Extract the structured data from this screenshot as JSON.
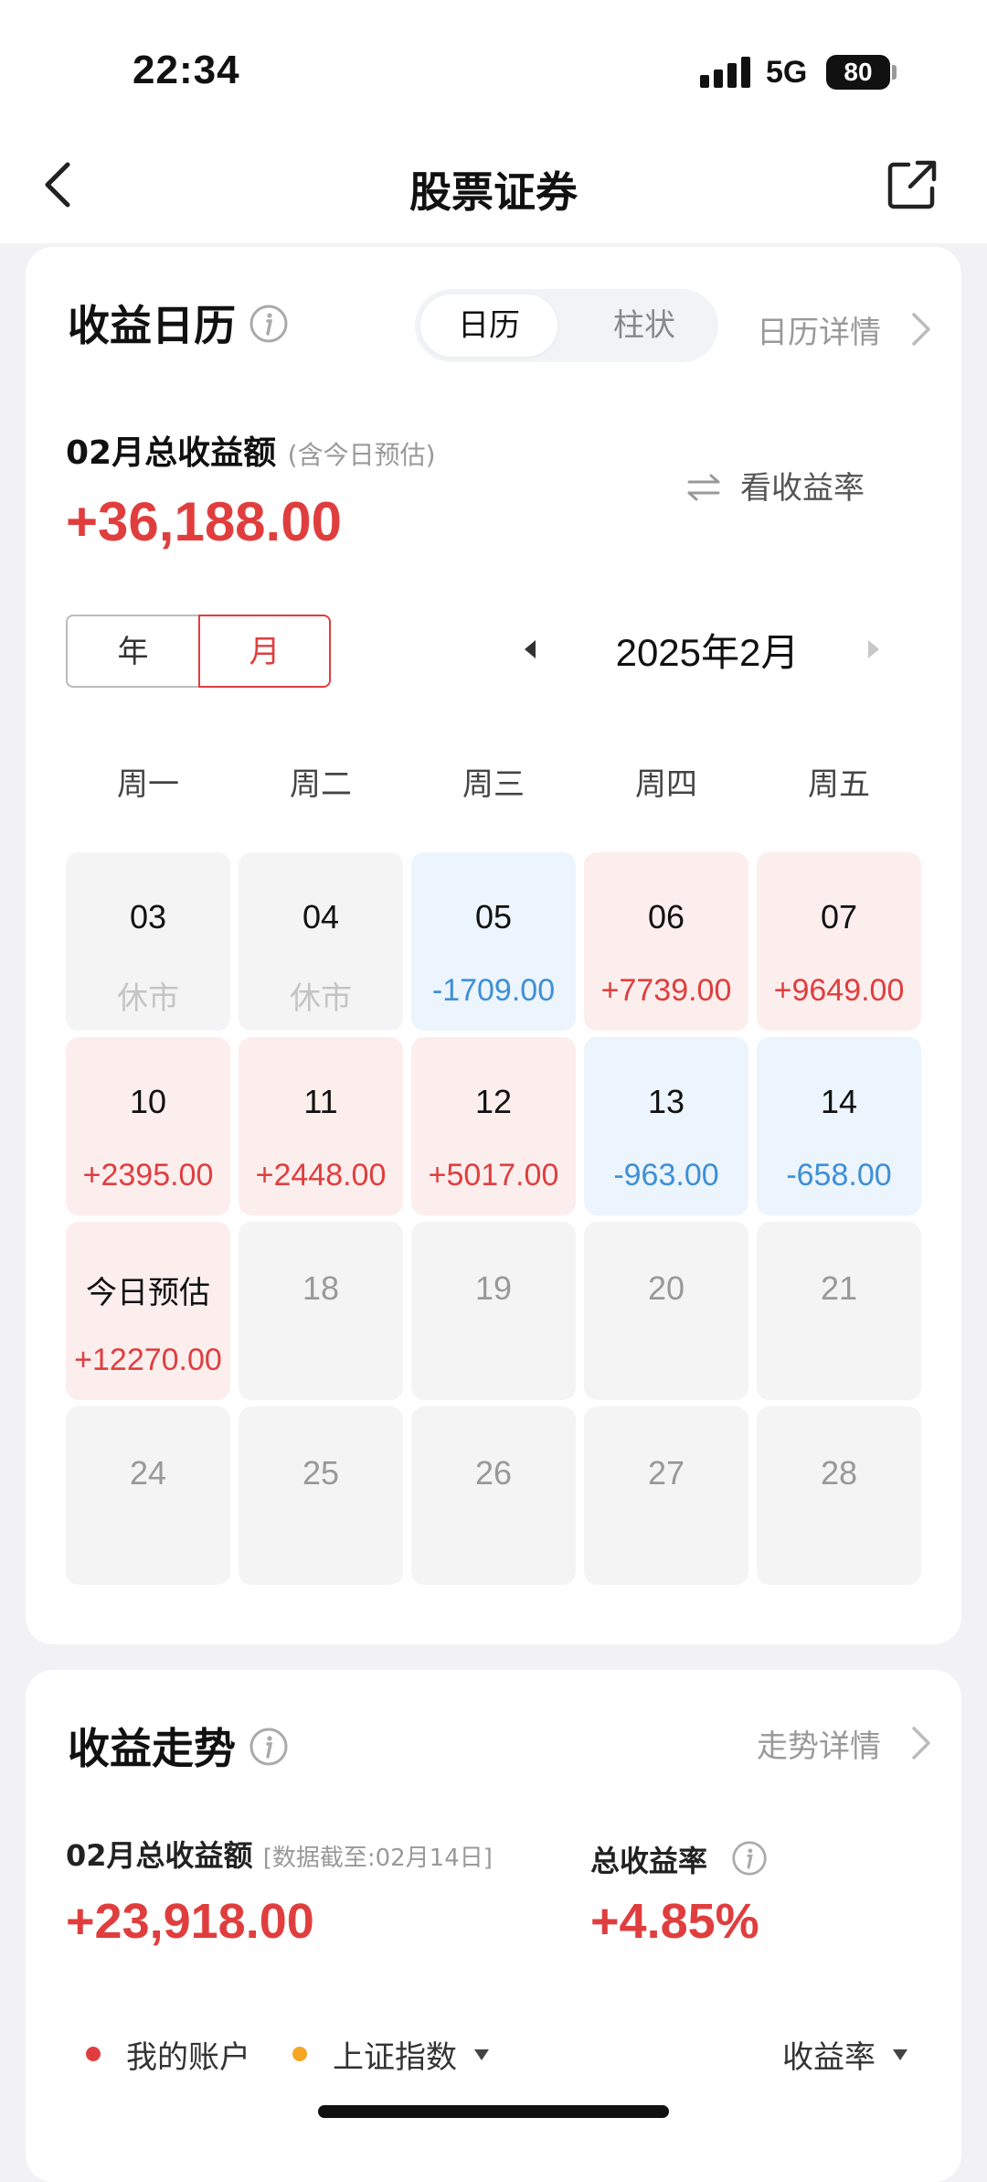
{
  "status_bar": {
    "time": "22:34",
    "network": "5G",
    "battery": "80"
  },
  "nav": {
    "title": "股票证券"
  },
  "calendar_card": {
    "title": "收益日历",
    "view_tabs": [
      "日历",
      "柱状"
    ],
    "detail_link": "日历详情",
    "total_label": "02月总收益额",
    "total_note": "(含今日预估)",
    "total_amount": "+36,188.00",
    "switch_link": "看收益率",
    "period_toggle": [
      "年",
      "月"
    ],
    "month_label": "2025年2月",
    "weekdays": [
      "周一",
      "周二",
      "周三",
      "周四",
      "周五"
    ],
    "days": [
      {
        "day": "03",
        "value": "休市",
        "kind": "closed"
      },
      {
        "day": "04",
        "value": "休市",
        "kind": "closed"
      },
      {
        "day": "05",
        "value": "-1709.00",
        "kind": "neg"
      },
      {
        "day": "06",
        "value": "+7739.00",
        "kind": "pos"
      },
      {
        "day": "07",
        "value": "+9649.00",
        "kind": "pos"
      },
      {
        "day": "10",
        "value": "+2395.00",
        "kind": "pos"
      },
      {
        "day": "11",
        "value": "+2448.00",
        "kind": "pos"
      },
      {
        "day": "12",
        "value": "+5017.00",
        "kind": "pos"
      },
      {
        "day": "13",
        "value": "-963.00",
        "kind": "neg"
      },
      {
        "day": "14",
        "value": "-658.00",
        "kind": "neg"
      },
      {
        "day": "今日预估",
        "value": "+12270.00",
        "kind": "today"
      },
      {
        "day": "18",
        "value": "",
        "kind": "future"
      },
      {
        "day": "19",
        "value": "",
        "kind": "future"
      },
      {
        "day": "20",
        "value": "",
        "kind": "future"
      },
      {
        "day": "21",
        "value": "",
        "kind": "future"
      },
      {
        "day": "24",
        "value": "",
        "kind": "future"
      },
      {
        "day": "25",
        "value": "",
        "kind": "future"
      },
      {
        "day": "26",
        "value": "",
        "kind": "future"
      },
      {
        "day": "27",
        "value": "",
        "kind": "future"
      },
      {
        "day": "28",
        "value": "",
        "kind": "future"
      }
    ]
  },
  "trend_card": {
    "title": "收益走势",
    "detail_link": "走势详情",
    "total_label": "02月总收益额",
    "total_note": "[数据截至:02月14日]",
    "total_amount": "+23,918.00",
    "rate_label": "总收益率",
    "rate_value": "+4.85%",
    "legend": [
      {
        "label": "我的账户",
        "color": "#e03e3e"
      },
      {
        "label": "上证指数",
        "color": "#f5a623"
      }
    ],
    "metric_select": "收益率"
  },
  "colors": {
    "positive": "#e03e3e",
    "negative": "#3f8fd6"
  }
}
